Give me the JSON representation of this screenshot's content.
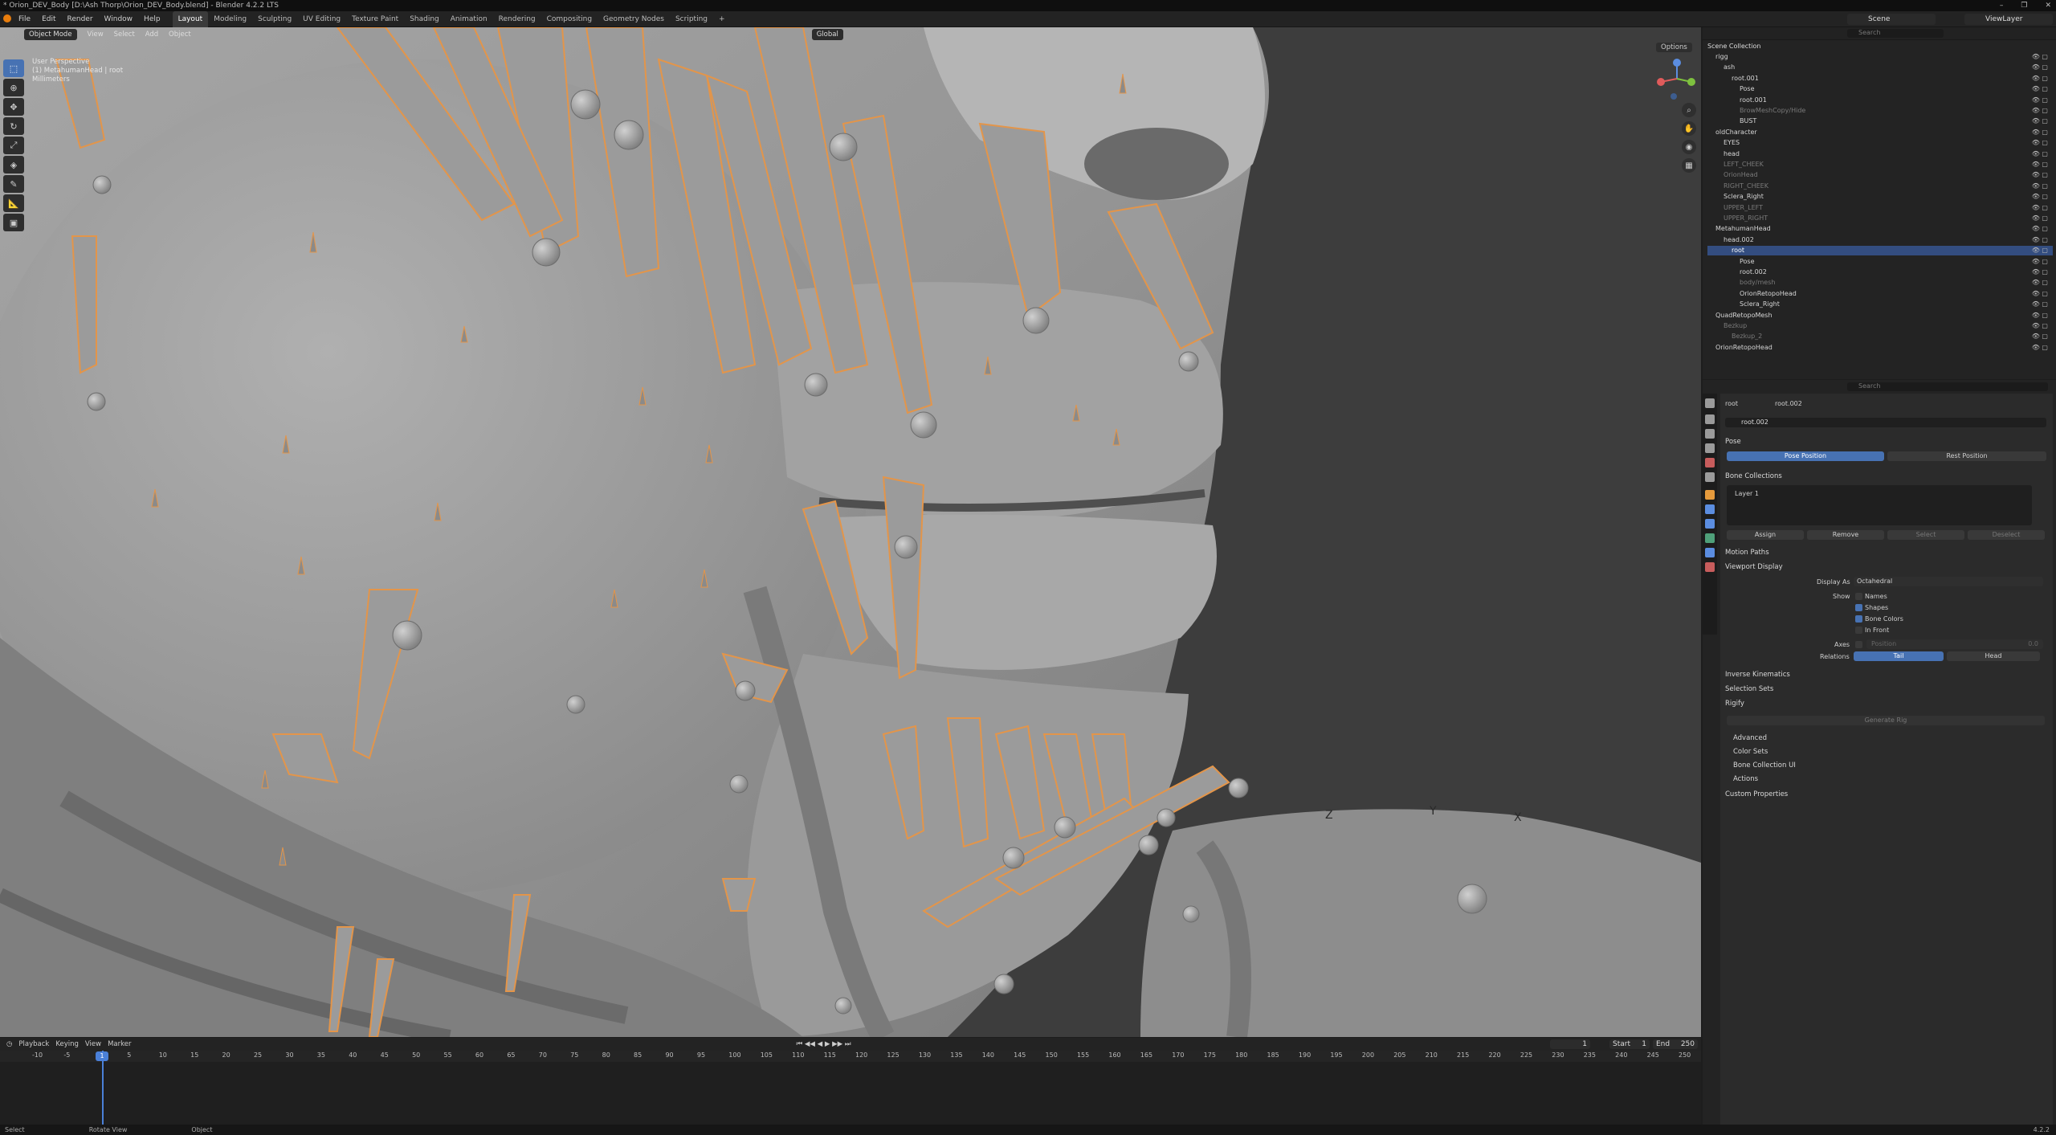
{
  "window": {
    "title": "* Orion_DEV_Body [D:\\Ash Thorp\\Orion_DEV_Body.blend] - Blender 4.2.2 LTS",
    "controls": [
      "–",
      "❐",
      "✕"
    ]
  },
  "topbar": {
    "menus": [
      "File",
      "Edit",
      "Render",
      "Window",
      "Help"
    ],
    "workspaces": [
      "Layout",
      "Modeling",
      "Sculpting",
      "UV Editing",
      "Texture Paint",
      "Shading",
      "Animation",
      "Rendering",
      "Compositing",
      "Geometry Nodes",
      "Scripting"
    ],
    "active_workspace": "Layout",
    "scene": "Scene",
    "view_layer": "ViewLayer"
  },
  "viewport": {
    "mode": "Object Mode",
    "menus": [
      "View",
      "Select",
      "Add",
      "Object"
    ],
    "transform_orientation": "Global",
    "info_line1": "User Perspective",
    "info_line2": "(1) MetahumanHead | root",
    "info_line3": "Millimeters",
    "options": "Options",
    "axis_labels": [
      "Z",
      "Y",
      "X"
    ]
  },
  "timeline": {
    "menus": [
      "Playback",
      "Keying",
      "View",
      "Marker"
    ],
    "current_frame": "1",
    "start_label": "Start",
    "start": "1",
    "end_label": "End",
    "end": "250",
    "ticks": [
      "-10",
      "-5",
      "1",
      "5",
      "10",
      "15",
      "20",
      "25",
      "30",
      "35",
      "40",
      "45",
      "50",
      "55",
      "60",
      "65",
      "70",
      "75",
      "80",
      "85",
      "90",
      "95",
      "100",
      "105",
      "110",
      "115",
      "120",
      "125",
      "130",
      "135",
      "140",
      "145",
      "150",
      "155",
      "160",
      "165",
      "170",
      "175",
      "180",
      "185",
      "190",
      "195",
      "200",
      "205",
      "210",
      "215",
      "220",
      "225",
      "230",
      "235",
      "240",
      "245",
      "250"
    ]
  },
  "statusbar": {
    "items": [
      "Select",
      "Rotate View",
      "Object"
    ],
    "version": "4.2.2"
  },
  "outliner": {
    "root": "Scene Collection",
    "rows": [
      {
        "label": "rigg",
        "indent": 1,
        "dim": false
      },
      {
        "label": "ash",
        "indent": 2,
        "dim": false
      },
      {
        "label": "root.001",
        "indent": 3,
        "dim": false
      },
      {
        "label": "Pose",
        "indent": 4,
        "dim": false
      },
      {
        "label": "root.001",
        "indent": 4,
        "dim": false
      },
      {
        "label": "BrowMeshCopy/Hide",
        "indent": 4,
        "dim": true
      },
      {
        "label": "BUST",
        "indent": 4,
        "dim": false
      },
      {
        "label": "oldCharacter",
        "indent": 1,
        "dim": false
      },
      {
        "label": "EYES",
        "indent": 2,
        "dim": false
      },
      {
        "label": "head",
        "indent": 2,
        "dim": false
      },
      {
        "label": "LEFT_CHEEK",
        "indent": 2,
        "dim": true
      },
      {
        "label": "OrionHead",
        "indent": 2,
        "dim": true
      },
      {
        "label": "RIGHT_CHEEK",
        "indent": 2,
        "dim": true
      },
      {
        "label": "Sclera_Right",
        "indent": 2,
        "dim": false
      },
      {
        "label": "UPPER_LEFT",
        "indent": 2,
        "dim": true
      },
      {
        "label": "UPPER_RIGHT",
        "indent": 2,
        "dim": true
      },
      {
        "label": "MetahumanHead",
        "indent": 1,
        "dim": false
      },
      {
        "label": "head.002",
        "indent": 2,
        "dim": false
      },
      {
        "label": "root",
        "indent": 3,
        "dim": false,
        "selected": true
      },
      {
        "label": "Pose",
        "indent": 4,
        "dim": false
      },
      {
        "label": "root.002",
        "indent": 4,
        "dim": false
      },
      {
        "label": "body/mesh",
        "indent": 4,
        "dim": true
      },
      {
        "label": "OrionRetopoHead",
        "indent": 4,
        "dim": false
      },
      {
        "label": "Sclera_Right",
        "indent": 4,
        "dim": false
      },
      {
        "label": "QuadRetopoMesh",
        "indent": 1,
        "dim": false
      },
      {
        "label": "Bezkup",
        "indent": 2,
        "dim": true
      },
      {
        "label": "Bezkup_2",
        "indent": 3,
        "dim": true
      },
      {
        "label": "OrionRetopoHead",
        "indent": 1,
        "dim": false
      }
    ]
  },
  "properties": {
    "breadcrumb": [
      "root",
      "root.002"
    ],
    "name_field": "root.002",
    "search_placeholder": "Search",
    "sections": {
      "pose": "Pose",
      "pose_position": "Pose Position",
      "rest_position": "Rest Position",
      "bone_collections": "Bone Collections",
      "layer": "Layer 1",
      "assign": "Assign",
      "remove": "Remove",
      "select": "Select",
      "deselect": "Deselect",
      "motion_paths": "Motion Paths",
      "viewport_display": "Viewport Display",
      "display_as_label": "Display As",
      "display_as_value": "Octahedral",
      "show_label": "Show",
      "names": "Names",
      "shapes": "Shapes",
      "bone_colors": "Bone Colors",
      "in_front": "In Front",
      "axes_label": "Axes",
      "axes_position": "Position",
      "axes_value": "0.0",
      "relations_label": "Relations",
      "tail": "Tail",
      "head": "Head",
      "inverse_kinematics": "Inverse Kinematics",
      "selection_sets": "Selection Sets",
      "rigify": "Rigify",
      "generate_rig": "Generate Rig",
      "advanced": "Advanced",
      "color_sets": "Color Sets",
      "bone_collection_ui": "Bone Collection UI",
      "actions": "Actions",
      "custom_properties": "Custom Properties"
    }
  },
  "colors": {
    "accent": "#4772b3",
    "bone_outline": "#e3954a",
    "viewport_bg": "#3d3d3d"
  }
}
